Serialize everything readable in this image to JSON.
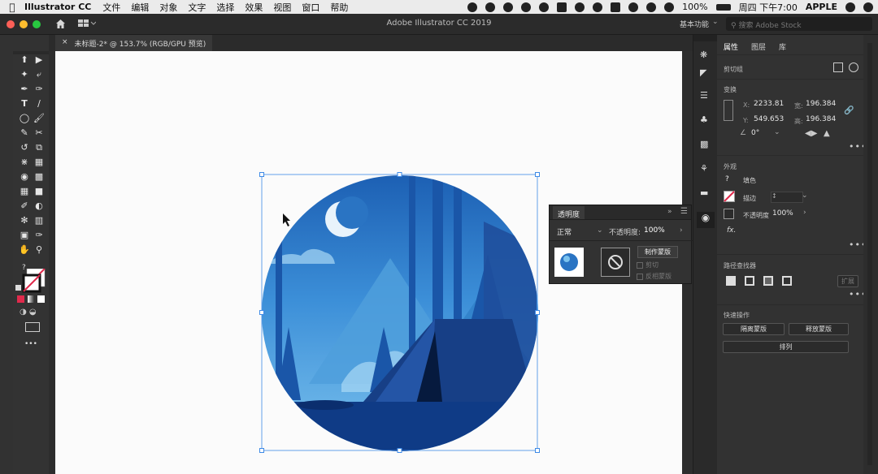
{
  "menubar": {
    "app_name": "Illustrator CC",
    "menus": [
      "文件",
      "编辑",
      "对象",
      "文字",
      "选择",
      "效果",
      "视图",
      "窗口",
      "帮助"
    ],
    "battery": "100%",
    "clock": "周四 下午7:00",
    "user": "APPLE"
  },
  "window": {
    "title": "Adobe Illustrator CC 2019",
    "workspace": "基本功能",
    "stock_search_placeholder": "搜索 Adobe Stock"
  },
  "doc_tab": {
    "close": "×",
    "label": "未标题-2* @ 153.7% (RGB/GPU 预览)"
  },
  "tools": [
    "selection",
    "direct-selection",
    "magic-wand",
    "lasso",
    "pen",
    "curvature",
    "type",
    "line",
    "ellipse",
    "paintbrush",
    "shaper",
    "scissors",
    "rotate",
    "scale",
    "width",
    "free-transform",
    "shape-builder",
    "perspective",
    "mesh",
    "gradient",
    "eyedropper",
    "blend",
    "symbol-sprayer",
    "column-graph",
    "artboard",
    "slice",
    "hand",
    "zoom"
  ],
  "tool_swatch_question": "?",
  "tool_more": "•••",
  "properties_panel": {
    "tabs": [
      "属性",
      "图层",
      "库"
    ],
    "object_type": "剪切组",
    "transform": {
      "title": "变换",
      "x_label": "X:",
      "x": "2233.81",
      "y_label": "Y:",
      "y": "549.653",
      "w_label": "宽:",
      "w": "196.384",
      "h_label": "高:",
      "h": "196.384",
      "angle": "0°"
    },
    "appearance": {
      "title": "外观",
      "fill_label": "填色",
      "stroke_label": "描边",
      "opacity_label": "不透明度",
      "opacity": "100%",
      "fill_question": "?",
      "fx": "fx."
    },
    "pathfinder": {
      "title": "路径查找器",
      "expand_label": "扩展"
    },
    "quick_actions": {
      "title": "快速操作",
      "release_mask": "隔离蒙版",
      "release_clip": "释放蒙版",
      "arrange": "排列"
    },
    "more": "•••"
  },
  "transparency_panel": {
    "title": "透明度",
    "collapse": "»",
    "blend_mode": "正常",
    "opacity_label": "不透明度:",
    "opacity": "100%",
    "make_mask": "制作蒙版",
    "clip_label": "剪切",
    "invert_label": "反相蒙版"
  },
  "colors": {
    "sky_top": "#1c5fb3",
    "sky_mid": "#3c8fd8",
    "sky_bottom": "#7cc3ee",
    "mountain": "#4f9fdc",
    "tree": "#1a56a8",
    "tent": "#173f86",
    "ground": "#0f3b86",
    "selection": "#3e8ae6",
    "panel_bg": "#323232",
    "accent_red": "#e02a4c"
  }
}
